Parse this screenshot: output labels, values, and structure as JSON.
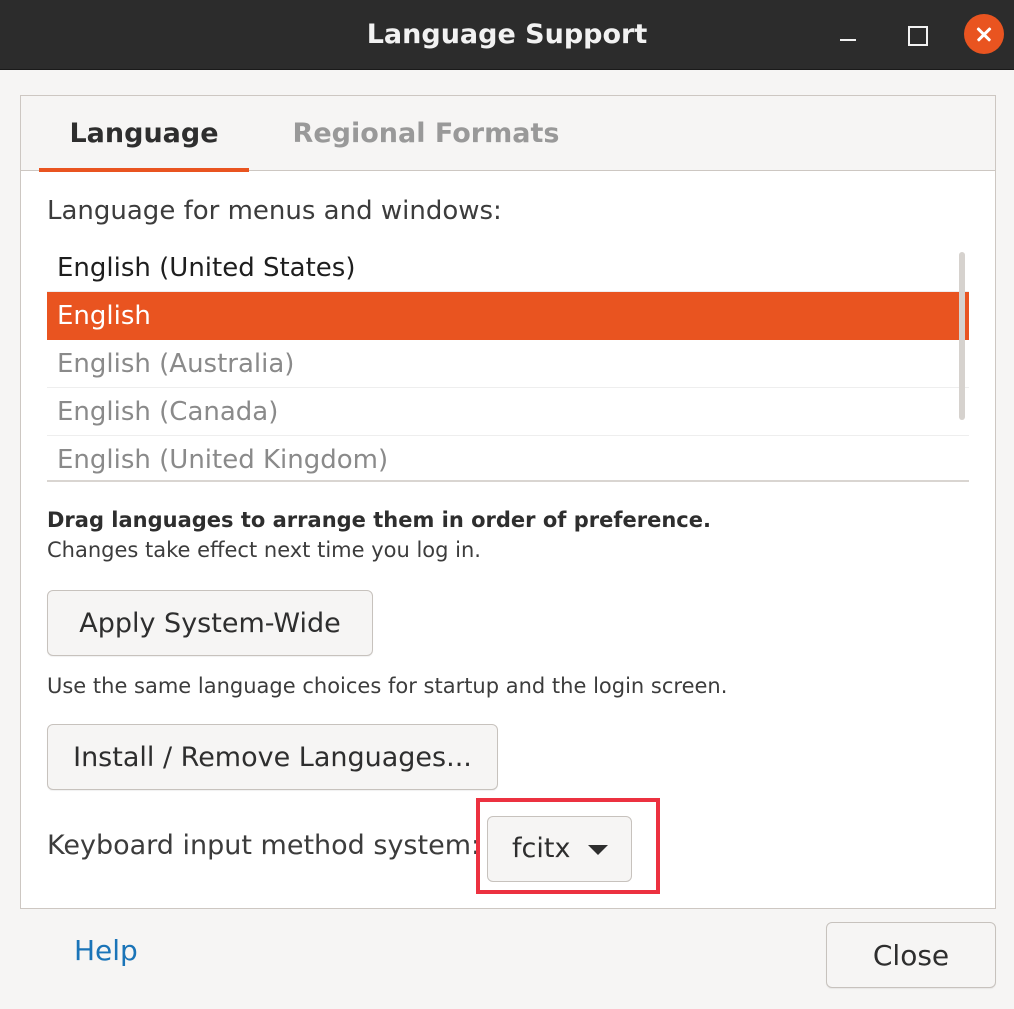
{
  "window": {
    "title": "Language Support"
  },
  "tabs": [
    {
      "label": "Language",
      "active": true
    },
    {
      "label": "Regional Formats",
      "active": false
    }
  ],
  "language_section": {
    "label": "Language for menus and windows:",
    "languages": [
      {
        "name": "English (United States)",
        "selected": false
      },
      {
        "name": "English",
        "selected": true
      },
      {
        "name": "English (Australia)",
        "selected": false
      },
      {
        "name": "English (Canada)",
        "selected": false
      },
      {
        "name": "English (United Kingdom)",
        "selected": false
      }
    ],
    "hint_bold": "Drag languages to arrange them in order of preference.",
    "hint": "Changes take effect next time you log in."
  },
  "buttons": {
    "apply_system_wide": "Apply System-Wide",
    "apply_hint": "Use the same language choices for startup and the login screen.",
    "install_remove": "Install / Remove Languages..."
  },
  "keyboard": {
    "label": "Keyboard input method system:",
    "value": "fcitx"
  },
  "footer": {
    "help": "Help",
    "close": "Close"
  },
  "colors": {
    "accent": "#e95420",
    "highlight_box": "#ec3140",
    "link": "#1a74b8",
    "titlebar": "#2c2c2c"
  },
  "icons": {
    "minimize": "minimize-icon",
    "maximize": "maximize-icon",
    "close": "close-icon",
    "dropdown": "chevron-down-icon"
  }
}
